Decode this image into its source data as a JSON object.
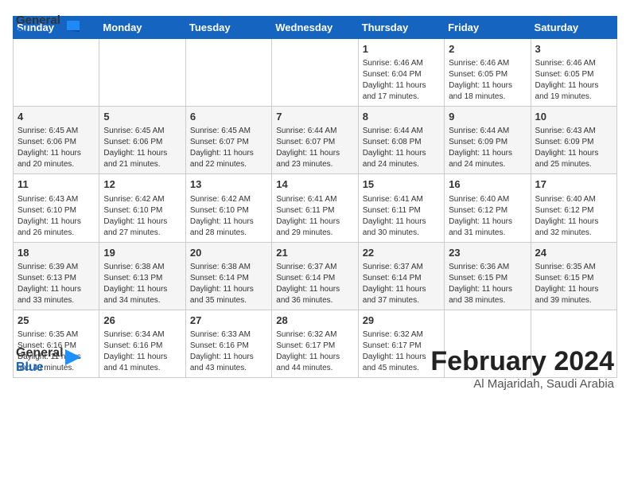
{
  "header": {
    "logo": {
      "general": "General",
      "blue": "Blue"
    },
    "title": "February 2024",
    "subtitle": "Al Majaridah, Saudi Arabia"
  },
  "days_of_week": [
    "Sunday",
    "Monday",
    "Tuesday",
    "Wednesday",
    "Thursday",
    "Friday",
    "Saturday"
  ],
  "weeks": [
    [
      {
        "day": "",
        "info": ""
      },
      {
        "day": "",
        "info": ""
      },
      {
        "day": "",
        "info": ""
      },
      {
        "day": "",
        "info": ""
      },
      {
        "day": "1",
        "info": "Sunrise: 6:46 AM\nSunset: 6:04 PM\nDaylight: 11 hours and 17 minutes."
      },
      {
        "day": "2",
        "info": "Sunrise: 6:46 AM\nSunset: 6:05 PM\nDaylight: 11 hours and 18 minutes."
      },
      {
        "day": "3",
        "info": "Sunrise: 6:46 AM\nSunset: 6:05 PM\nDaylight: 11 hours and 19 minutes."
      }
    ],
    [
      {
        "day": "4",
        "info": "Sunrise: 6:45 AM\nSunset: 6:06 PM\nDaylight: 11 hours and 20 minutes."
      },
      {
        "day": "5",
        "info": "Sunrise: 6:45 AM\nSunset: 6:06 PM\nDaylight: 11 hours and 21 minutes."
      },
      {
        "day": "6",
        "info": "Sunrise: 6:45 AM\nSunset: 6:07 PM\nDaylight: 11 hours and 22 minutes."
      },
      {
        "day": "7",
        "info": "Sunrise: 6:44 AM\nSunset: 6:07 PM\nDaylight: 11 hours and 23 minutes."
      },
      {
        "day": "8",
        "info": "Sunrise: 6:44 AM\nSunset: 6:08 PM\nDaylight: 11 hours and 24 minutes."
      },
      {
        "day": "9",
        "info": "Sunrise: 6:44 AM\nSunset: 6:09 PM\nDaylight: 11 hours and 24 minutes."
      },
      {
        "day": "10",
        "info": "Sunrise: 6:43 AM\nSunset: 6:09 PM\nDaylight: 11 hours and 25 minutes."
      }
    ],
    [
      {
        "day": "11",
        "info": "Sunrise: 6:43 AM\nSunset: 6:10 PM\nDaylight: 11 hours and 26 minutes."
      },
      {
        "day": "12",
        "info": "Sunrise: 6:42 AM\nSunset: 6:10 PM\nDaylight: 11 hours and 27 minutes."
      },
      {
        "day": "13",
        "info": "Sunrise: 6:42 AM\nSunset: 6:10 PM\nDaylight: 11 hours and 28 minutes."
      },
      {
        "day": "14",
        "info": "Sunrise: 6:41 AM\nSunset: 6:11 PM\nDaylight: 11 hours and 29 minutes."
      },
      {
        "day": "15",
        "info": "Sunrise: 6:41 AM\nSunset: 6:11 PM\nDaylight: 11 hours and 30 minutes."
      },
      {
        "day": "16",
        "info": "Sunrise: 6:40 AM\nSunset: 6:12 PM\nDaylight: 11 hours and 31 minutes."
      },
      {
        "day": "17",
        "info": "Sunrise: 6:40 AM\nSunset: 6:12 PM\nDaylight: 11 hours and 32 minutes."
      }
    ],
    [
      {
        "day": "18",
        "info": "Sunrise: 6:39 AM\nSunset: 6:13 PM\nDaylight: 11 hours and 33 minutes."
      },
      {
        "day": "19",
        "info": "Sunrise: 6:38 AM\nSunset: 6:13 PM\nDaylight: 11 hours and 34 minutes."
      },
      {
        "day": "20",
        "info": "Sunrise: 6:38 AM\nSunset: 6:14 PM\nDaylight: 11 hours and 35 minutes."
      },
      {
        "day": "21",
        "info": "Sunrise: 6:37 AM\nSunset: 6:14 PM\nDaylight: 11 hours and 36 minutes."
      },
      {
        "day": "22",
        "info": "Sunrise: 6:37 AM\nSunset: 6:14 PM\nDaylight: 11 hours and 37 minutes."
      },
      {
        "day": "23",
        "info": "Sunrise: 6:36 AM\nSunset: 6:15 PM\nDaylight: 11 hours and 38 minutes."
      },
      {
        "day": "24",
        "info": "Sunrise: 6:35 AM\nSunset: 6:15 PM\nDaylight: 11 hours and 39 minutes."
      }
    ],
    [
      {
        "day": "25",
        "info": "Sunrise: 6:35 AM\nSunset: 6:16 PM\nDaylight: 11 hours and 40 minutes."
      },
      {
        "day": "26",
        "info": "Sunrise: 6:34 AM\nSunset: 6:16 PM\nDaylight: 11 hours and 41 minutes."
      },
      {
        "day": "27",
        "info": "Sunrise: 6:33 AM\nSunset: 6:16 PM\nDaylight: 11 hours and 43 minutes."
      },
      {
        "day": "28",
        "info": "Sunrise: 6:32 AM\nSunset: 6:17 PM\nDaylight: 11 hours and 44 minutes."
      },
      {
        "day": "29",
        "info": "Sunrise: 6:32 AM\nSunset: 6:17 PM\nDaylight: 11 hours and 45 minutes."
      },
      {
        "day": "",
        "info": ""
      },
      {
        "day": "",
        "info": ""
      }
    ]
  ]
}
